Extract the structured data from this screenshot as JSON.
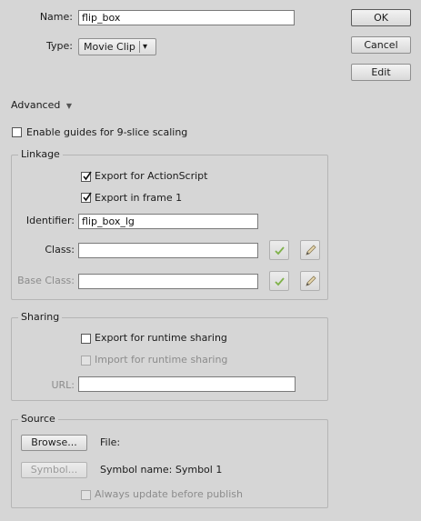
{
  "symbol": {
    "name_label": "Name:",
    "name_value": "flip_box",
    "type_label": "Type:",
    "type_value": "Movie Clip",
    "type_arrow": "▾"
  },
  "buttons": {
    "ok": "OK",
    "cancel": "Cancel",
    "edit": "Edit"
  },
  "advanced": {
    "label": "Advanced",
    "arrow": "▼",
    "nine_slice": "Enable guides for 9-slice scaling",
    "nine_slice_checked": false
  },
  "linkage": {
    "title": "Linkage",
    "export_actionscript": "Export for ActionScript",
    "export_actionscript_checked": true,
    "export_frame1": "Export in frame 1",
    "export_frame1_checked": true,
    "identifier_label": "Identifier:",
    "identifier_value": "flip_box_lg",
    "class_label": "Class:",
    "class_value": "",
    "base_class_label": "Base Class:",
    "base_class_value": "",
    "validate_icon": "checkmark-icon",
    "edit_icon": "pencil-icon"
  },
  "sharing": {
    "title": "Sharing",
    "export_runtime": "Export for runtime sharing",
    "export_runtime_checked": false,
    "import_runtime": "Import for runtime sharing",
    "import_runtime_checked": false,
    "url_label": "URL:",
    "url_value": ""
  },
  "source": {
    "title": "Source",
    "browse_button": "Browse...",
    "file_label": "File:",
    "symbol_button": "Symbol...",
    "symbol_name": "Symbol name: Symbol 1",
    "always_update": "Always update before publish",
    "always_update_checked": false
  },
  "colors": {
    "background": "#d6d6d6",
    "disabled_text": "#8c8c8c",
    "check_green": "#7fb24a"
  }
}
